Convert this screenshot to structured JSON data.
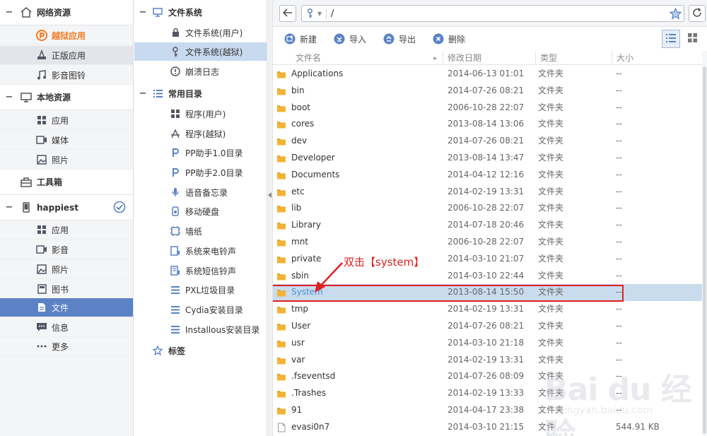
{
  "sidebar": {
    "groups": [
      {
        "label": "网络资源",
        "icon": "home-icon"
      },
      {
        "label": "本地资源",
        "icon": "monitor-icon"
      },
      {
        "label": "工具箱",
        "icon": "toolbox-icon"
      },
      {
        "label": "happiest",
        "icon": "phone-icon"
      }
    ],
    "items": [
      {
        "label": "越狱应用",
        "icon": "pp-icon"
      },
      {
        "label": "正版应用",
        "icon": "appstore-icon"
      },
      {
        "label": "影音图铃",
        "icon": "music-icon"
      },
      {
        "label": "应用",
        "icon": "apps-icon"
      },
      {
        "label": "媒体",
        "icon": "media-icon"
      },
      {
        "label": "照片",
        "icon": "photo-icon"
      },
      {
        "label": "应用",
        "icon": "apps-icon"
      },
      {
        "label": "影音",
        "icon": "video-icon"
      },
      {
        "label": "照片",
        "icon": "photo-icon"
      },
      {
        "label": "图书",
        "icon": "book-icon"
      },
      {
        "label": "文件",
        "icon": "file-icon"
      },
      {
        "label": "信息",
        "icon": "message-icon"
      },
      {
        "label": "更多",
        "icon": "more-icon"
      }
    ]
  },
  "tree": {
    "sections": [
      {
        "label": "文件系统",
        "icon": "monitor-icon"
      },
      {
        "label": "常用目录",
        "icon": "list-icon"
      },
      {
        "label": "标签",
        "icon": "star-icon"
      }
    ],
    "items": [
      {
        "label": "文件系统(用户)",
        "icon": "lock-icon"
      },
      {
        "label": "文件系统(越狱)",
        "icon": "key-icon"
      },
      {
        "label": "崩溃日志",
        "icon": "alert-icon"
      },
      {
        "label": "程序(用户)",
        "icon": "grid-icon"
      },
      {
        "label": "程序(越狱)",
        "icon": "appstore-icon"
      },
      {
        "label": "PP助手1.0目录",
        "icon": "pp-icon"
      },
      {
        "label": "PP助手2.0目录",
        "icon": "pp-icon"
      },
      {
        "label": "语音备忘录",
        "icon": "mic-icon"
      },
      {
        "label": "移动硬盘",
        "icon": "drive-icon"
      },
      {
        "label": "墙纸",
        "icon": "wallpaper-icon"
      },
      {
        "label": "系统来电铃声",
        "icon": "ringtone-icon"
      },
      {
        "label": "系统短信铃声",
        "icon": "sms-tone-icon"
      },
      {
        "label": "PXL垃圾目录",
        "icon": "list-icon"
      },
      {
        "label": "Cydia安装目录",
        "icon": "list-icon"
      },
      {
        "label": "Installous安装目录",
        "icon": "list-icon"
      }
    ]
  },
  "address": {
    "path": "/"
  },
  "toolbar": {
    "new_label": "新建",
    "import_label": "导入",
    "export_label": "导出",
    "delete_label": "删除"
  },
  "columns": {
    "name": "文件名",
    "date": "修改日期",
    "type": "类型",
    "size": "大小"
  },
  "files": [
    {
      "name": "Applications",
      "date": "2014-06-13 01:01",
      "type": "文件夹",
      "size": "--"
    },
    {
      "name": "bin",
      "date": "2014-07-26 08:21",
      "type": "文件夹",
      "size": "--"
    },
    {
      "name": "boot",
      "date": "2006-10-28 22:07",
      "type": "文件夹",
      "size": "--"
    },
    {
      "name": "cores",
      "date": "2013-08-14 13:06",
      "type": "文件夹",
      "size": "--"
    },
    {
      "name": "dev",
      "date": "2014-07-26 08:21",
      "type": "文件夹",
      "size": "--"
    },
    {
      "name": "Developer",
      "date": "2013-08-14 13:47",
      "type": "文件夹",
      "size": "--"
    },
    {
      "name": "Documents",
      "date": "2014-04-12 12:16",
      "type": "文件夹",
      "size": "--"
    },
    {
      "name": "etc",
      "date": "2014-02-19 13:31",
      "type": "文件夹",
      "size": "--"
    },
    {
      "name": "lib",
      "date": "2006-10-28 22:07",
      "type": "文件夹",
      "size": "--"
    },
    {
      "name": "Library",
      "date": "2014-07-18 20:46",
      "type": "文件夹",
      "size": "--"
    },
    {
      "name": "mnt",
      "date": "2006-10-28 22:07",
      "type": "文件夹",
      "size": "--"
    },
    {
      "name": "private",
      "date": "2014-03-10 21:07",
      "type": "文件夹",
      "size": "--"
    },
    {
      "name": "sbin",
      "date": "2014-03-10 22:44",
      "type": "文件夹",
      "size": "--"
    },
    {
      "name": "System",
      "date": "2013-08-14 15:50",
      "type": "文件夹",
      "size": "--"
    },
    {
      "name": "tmp",
      "date": "2014-02-19 13:31",
      "type": "文件夹",
      "size": "--"
    },
    {
      "name": "User",
      "date": "2014-07-26 08:21",
      "type": "文件夹",
      "size": "--"
    },
    {
      "name": "usr",
      "date": "2014-03-10 21:18",
      "type": "文件夹",
      "size": "--"
    },
    {
      "name": "var",
      "date": "2014-02-19 13:31",
      "type": "文件夹",
      "size": "--"
    },
    {
      "name": ".fseventsd",
      "date": "2014-07-26 08:09",
      "type": "文件夹",
      "size": "--"
    },
    {
      "name": ".Trashes",
      "date": "2014-02-19 13:33",
      "type": "文件夹",
      "size": "--"
    },
    {
      "name": "91",
      "date": "2014-04-17 23:38",
      "type": "文件夹",
      "size": "--"
    },
    {
      "name": "evasi0n7",
      "date": "2014-03-10 21:15",
      "type": "文件",
      "size": "544.91 KB"
    }
  ],
  "annotation": "双击【system】",
  "watermark": {
    "logo": "Bai du 经验",
    "url": "jingyan.baidu.com"
  },
  "colors": {
    "accent": "#5a82c5",
    "orange": "#f47b20",
    "highlight_red": "#e02020",
    "folder": "#f2b437"
  }
}
